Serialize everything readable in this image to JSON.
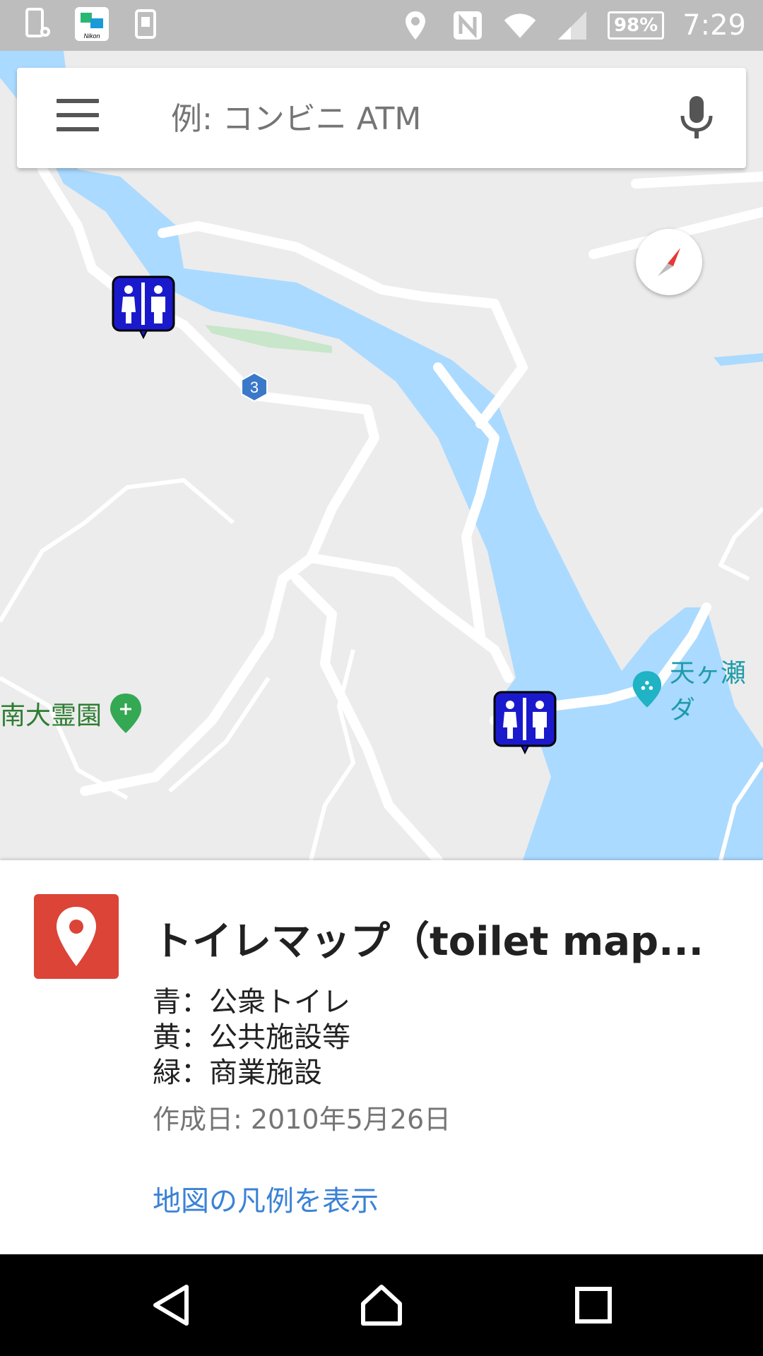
{
  "status_bar": {
    "icons_left": [
      "screen-settings-icon",
      "nikon-app-icon",
      "sim-card-icon"
    ],
    "icons_right": [
      "location-icon",
      "nfc-icon",
      "wifi-icon",
      "signal-icon"
    ],
    "battery": "98%",
    "time": "7:29"
  },
  "search": {
    "placeholder": "例: コンビニ ATM",
    "value": ""
  },
  "map": {
    "places": [
      {
        "label": "南大霊園",
        "type": "cemetery"
      },
      {
        "label": "天ヶ瀬ダ",
        "type": "dam"
      }
    ],
    "route_badge": "3",
    "markers": [
      "public-toilet",
      "public-toilet"
    ]
  },
  "sheet": {
    "title": "トイレマップ（toilet map...",
    "lines": [
      "青：公衆トイレ",
      "黄：公共施設等",
      "緑：商業施設"
    ],
    "date": "作成日: 2010年5月26日",
    "legend_link": "地図の凡例を表示"
  },
  "colors": {
    "water": "#aadaff",
    "land": "#ececec",
    "road": "#ffffff",
    "marker_blue": "#1a1acc",
    "sheet_icon": "#db4437",
    "link": "#3b82d6"
  }
}
